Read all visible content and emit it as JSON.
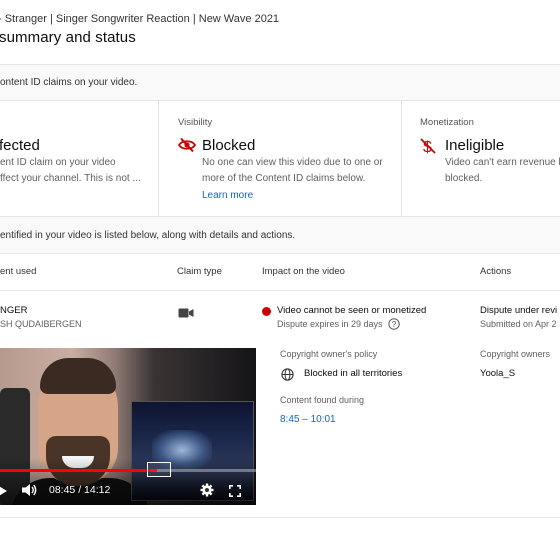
{
  "header": {
    "breadcrumb": "- Stranger | Singer Songwriter Reaction | New Wave 2021",
    "title": "summary and status"
  },
  "banner_claims": "ontent ID claims on your video.",
  "cards": {
    "copyright": {
      "status": "fected",
      "desc_line1": "ent ID claim on your video",
      "desc_line2": "ffect your channel. This is not ..."
    },
    "visibility": {
      "label": "Visibility",
      "status": "Blocked",
      "icon": "eye-off-icon",
      "desc_line1": "No one can view this video due to one or",
      "desc_line2": "more of the Content ID claims below.",
      "link": "Learn more"
    },
    "monetization": {
      "label": "Monetization",
      "status": "Ineligible",
      "icon": "no-money-icon",
      "desc_line1": "Video can't earn revenue b",
      "desc_line2": "blocked."
    }
  },
  "banner_content": "entified in your video is listed below, along with details and actions.",
  "table": {
    "headers": {
      "content": "ent used",
      "claim_type": "Claim type",
      "impact": "Impact on the video",
      "actions": "Actions"
    },
    "row": {
      "content_title": "NGER",
      "content_artist": "SH QUDAIBERGEN",
      "claim_icon": "video-camera-icon",
      "impact_status": "Video cannot be seen or monetized",
      "impact_sub": "Dispute expires in 29 days",
      "actions_status": "Dispute under revi",
      "actions_sub": "Submitted on Apr 2"
    }
  },
  "details": {
    "policy_label": "Copyright owner's policy",
    "policy_value": "Blocked in all territories",
    "owners_label": "Copyright owners",
    "owners_value": "Yoola_S",
    "found_label": "Content found during",
    "found_value": "8:45 – 10:01"
  },
  "player": {
    "time_display": "08:45 / 14:12",
    "progress": 0.615
  },
  "colors": {
    "accent_link": "#1565c0",
    "error_red": "#cc0000",
    "progress_red": "#ff0000"
  }
}
